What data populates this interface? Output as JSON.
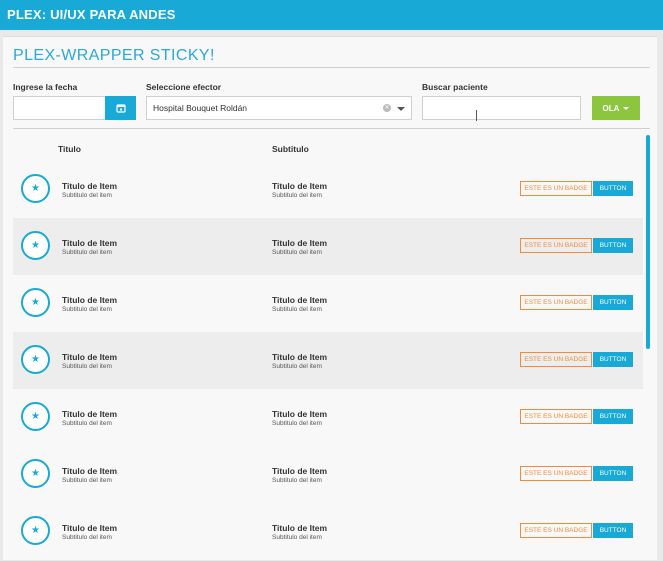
{
  "header": {
    "title": "PLEX: UI/UX PARA ANDES"
  },
  "wrapper": {
    "title": "PLEX-WRAPPER STICKY!"
  },
  "filters": {
    "date_label": "Ingrese la fecha",
    "date_value": "",
    "efector_label": "Seleccione efector",
    "efector_value": "Hospital Bouquet Roldán",
    "paciente_label": "Buscar paciente",
    "paciente_value": "",
    "ola_label": "OLA"
  },
  "list": {
    "col_titulo": "Titulo",
    "col_subtitulo": "Subtitulo",
    "items": [
      {
        "title": "Titulo de Item",
        "sub": "Subtitulo del item",
        "title2": "Titulo de Item",
        "sub2": "Subtitulo del item",
        "badge": "ESTE ES UN BADGE",
        "button": "BUTTON"
      },
      {
        "title": "Titulo de Item",
        "sub": "Subtitulo del item",
        "title2": "Titulo de Item",
        "sub2": "Subtitulo del item",
        "badge": "ESTE ES UN BADGE",
        "button": "BUTTON"
      },
      {
        "title": "Titulo de Item",
        "sub": "Subtitulo del item",
        "title2": "Titulo de Item",
        "sub2": "Subtitulo del item",
        "badge": "ESTE ES UN BADGE",
        "button": "BUTTON"
      },
      {
        "title": "Titulo de Item",
        "sub": "Subtitulo del item",
        "title2": "Titulo de Item",
        "sub2": "Subtitulo del item",
        "badge": "ESTE ES UN BADGE",
        "button": "BUTTON"
      },
      {
        "title": "Titulo de Item",
        "sub": "Subtitulo del item",
        "title2": "Titulo de Item",
        "sub2": "Subtitulo del item",
        "badge": "ESTE ES UN BADGE",
        "button": "BUTTON"
      },
      {
        "title": "Titulo de Item",
        "sub": "Subtitulo del item",
        "title2": "Titulo de Item",
        "sub2": "Subtitulo del item",
        "badge": "ESTE ES UN BADGE",
        "button": "BUTTON"
      },
      {
        "title": "Titulo de Item",
        "sub": "Subtitulo del item",
        "title2": "Titulo de Item",
        "sub2": "Subtitulo del item",
        "badge": "ESTE ES UN BADGE",
        "button": "BUTTON"
      }
    ]
  },
  "icons": {
    "date": "calendar-icon",
    "item": "star-icon"
  },
  "colors": {
    "primary": "#18a9d6",
    "success": "#8cc63f",
    "badge": "#f08a3c"
  }
}
